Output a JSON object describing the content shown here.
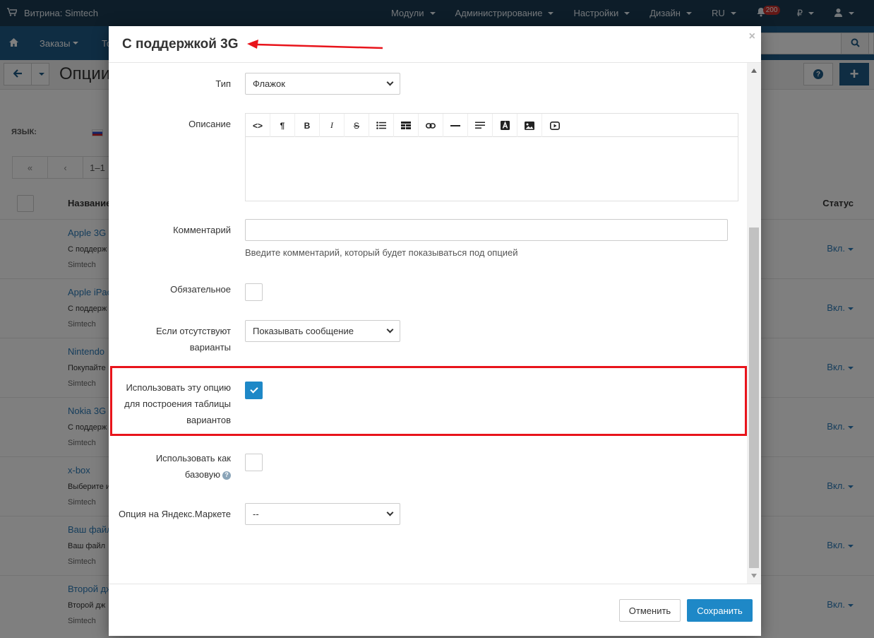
{
  "topbar": {
    "store": "Витрина: Simtech",
    "menu": [
      "Модули",
      "Администрирование",
      "Настройки",
      "Дизайн",
      "RU"
    ],
    "notifications": "200",
    "currency": "₽"
  },
  "subbar": {
    "tabs": [
      "Заказы",
      "То"
    ]
  },
  "page": {
    "title": "Опции"
  },
  "background": {
    "language_label": "ЯЗЫК:",
    "pager_text": "1–1",
    "col_name": "Название",
    "col_status": "Статус",
    "rows": [
      {
        "name": "Apple 3G",
        "desc": "С поддерж",
        "vendor": "Simtech",
        "status": "Вкл."
      },
      {
        "name": "Apple iPac",
        "desc": "С поддерж",
        "vendor": "Simtech",
        "status": "Вкл."
      },
      {
        "name": "Nintendo",
        "desc": "Покупайте",
        "vendor": "Simtech",
        "status": "Вкл."
      },
      {
        "name": "Nokia 3G",
        "desc": "С поддерж",
        "vendor": "Simtech",
        "status": "Вкл."
      },
      {
        "name": "x-box",
        "desc": "Выберите и",
        "vendor": "Simtech",
        "status": "Вкл."
      },
      {
        "name": "Ваш файл",
        "desc": "Ваш файл",
        "vendor": "Simtech",
        "status": "Вкл."
      },
      {
        "name": "Второй дж",
        "desc": "Второй дж",
        "vendor": "Simtech",
        "status": "Вкл."
      }
    ]
  },
  "modal": {
    "title": "С поддержкой 3G",
    "close": "×",
    "fields": {
      "type_label": "Тип",
      "type_value": "Флажок",
      "description_label": "Описание",
      "comment_label": "Комментарий",
      "comment_value": "",
      "comment_hint": "Введите комментарий, который будет показываться под опцией",
      "required_label": "Обязательное",
      "missing_label_1": "Если отсутствуют",
      "missing_label_2": "варианты",
      "missing_value": "Показывать сообщение",
      "inventory_label_1": "Использовать эту опцию",
      "inventory_label_2": "для построения таблицы",
      "inventory_label_3": "вариантов",
      "base_label_1": "Использовать как",
      "base_label_2": "базовую",
      "yandex_label": "Опция на Яндекс.Маркете",
      "yandex_value": "--"
    },
    "editor_toolbar": [
      "<>",
      "¶",
      "B",
      "I",
      "S",
      "list-icon",
      "table-icon",
      "link-icon",
      "hr-icon",
      "align-icon",
      "color-icon",
      "image-icon",
      "video-icon"
    ],
    "buttons": {
      "cancel": "Отменить",
      "save": "Сохранить"
    }
  },
  "colors": {
    "topbar": "#1b3a52",
    "subbar": "#1f5b86",
    "primary": "#1e88c7",
    "highlight": "#e8141b"
  }
}
